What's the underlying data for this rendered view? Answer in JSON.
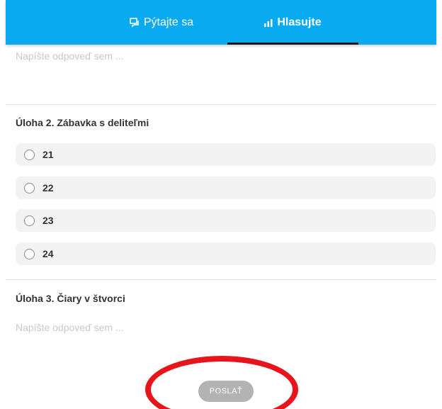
{
  "tabs": [
    {
      "label": "Pýtajte sa",
      "icon": "chat-icon",
      "active": false
    },
    {
      "label": "Hlasujte",
      "icon": "bar-chart-icon",
      "active": true
    }
  ],
  "question1": {
    "placeholder": "Napíšte odpoveď sem ..."
  },
  "question2": {
    "title": "Úloha 2. Zábavka s deliteľmi",
    "options": [
      "21",
      "22",
      "23",
      "24"
    ]
  },
  "question3": {
    "title": "Úloha 3. Čiary v štvorci",
    "placeholder": "Napíšte odpoveď sem ..."
  },
  "submit": {
    "label": "POSLAŤ"
  },
  "colors": {
    "topbar": "#0aaaf0",
    "highlight": "#e8141b",
    "button": "#b3b3b3"
  }
}
